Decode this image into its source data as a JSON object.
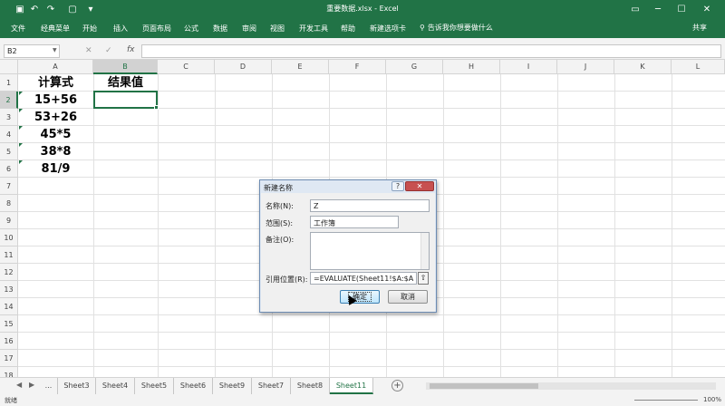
{
  "window": {
    "doc_title": "重要数据.xlsx  -  Excel"
  },
  "quick_access": {
    "icons": [
      "save-icon",
      "undo-icon",
      "redo-icon",
      "new-file-icon",
      "customize-icon"
    ]
  },
  "menu": {
    "items": [
      "文件",
      "经典菜单",
      "开始",
      "插入",
      "页面布局",
      "公式",
      "数据",
      "审阅",
      "视图",
      "开发工具",
      "帮助",
      "新建选项卡"
    ],
    "tell_me": "告诉我你想要做什么",
    "share": "共享"
  },
  "formula_bar": {
    "name_box": "B2",
    "fx": "fx",
    "cancel": "✕",
    "enter": "✓"
  },
  "columns": [
    "A",
    "B",
    "C",
    "D",
    "E",
    "F",
    "G",
    "H",
    "I",
    "J",
    "K",
    "L"
  ],
  "rows": [
    "1",
    "2",
    "3",
    "4",
    "5",
    "6",
    "7",
    "8",
    "9",
    "10",
    "11",
    "12",
    "13",
    "14",
    "15",
    "16",
    "17",
    "18"
  ],
  "cells": {
    "a1": "计算式",
    "b1": "结果值",
    "a2": "15+56",
    "a3": "53+26",
    "a4": "45*5",
    "a5": "38*8",
    "a6": "81/9"
  },
  "sheets": {
    "ellipsis": "...",
    "tabs": [
      "Sheet3",
      "Sheet4",
      "Sheet5",
      "Sheet6",
      "Sheet9",
      "Sheet7",
      "Sheet8",
      "Sheet11"
    ],
    "active": "Sheet11",
    "add": "+"
  },
  "status": {
    "ready": "就绪",
    "zoom": "100%"
  },
  "dialog": {
    "title": "新建名称",
    "help": "?",
    "close": "✕",
    "name_label": "名称(N):",
    "name_value": "Z",
    "scope_label": "范围(S):",
    "scope_value": "工作簿",
    "comment_label": "备注(O):",
    "comment_value": "",
    "refers_label": "引用位置(R):",
    "refers_value": "=EVALUATE(Sheet11!$A:$A )",
    "ok": "确定",
    "cancel": "取消"
  },
  "colors": {
    "accent": "#217346",
    "dialog_bg": "#dfe8f3"
  }
}
